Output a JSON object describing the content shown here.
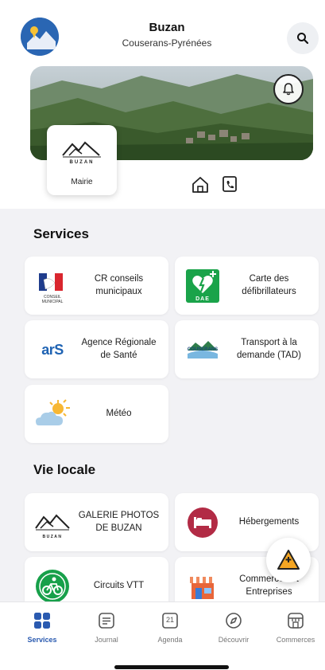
{
  "header": {
    "title": "Buzan",
    "subtitle": "Couserans-Pyrénées"
  },
  "mairie": {
    "logo_text": "BUZAN",
    "label": "Mairie"
  },
  "sections": {
    "services_title": "Services",
    "vie_locale_title": "Vie locale"
  },
  "services": [
    {
      "label": "CR conseils municipaux",
      "icon": "republique-francaise-logo",
      "icon_caption": "CONSEIL MUNICIPAL"
    },
    {
      "label": "Carte des défibrillateurs",
      "icon": "dae-defibrillator-icon",
      "icon_caption": "DAE"
    },
    {
      "label": "Agence Régionale de Santé",
      "icon": "ars-logo",
      "icon_caption": "arS"
    },
    {
      "label": "Transport à la demande (TAD)",
      "icon": "couserans-logo",
      "icon_caption": "COUSERANS"
    },
    {
      "label": "Météo",
      "icon": "weather-sun-cloud-icon"
    }
  ],
  "vie_locale": [
    {
      "label": "GALERIE PHOTOS DE BUZAN",
      "icon": "buzan-mountain-logo",
      "icon_caption": "BUZAN"
    },
    {
      "label": "Hébergements",
      "icon": "bed-icon"
    },
    {
      "label": "Circuits VTT",
      "icon": "bike-icon"
    },
    {
      "label": "Commerces et Entreprises",
      "icon": "shop-icon"
    }
  ],
  "bottom_nav": [
    {
      "label": "Services",
      "icon": "grid-icon",
      "active": true
    },
    {
      "label": "Journal",
      "icon": "newspaper-icon",
      "active": false
    },
    {
      "label": "Agenda",
      "icon": "calendar-icon",
      "active": false,
      "calendar_day": "21"
    },
    {
      "label": "Découvrir",
      "icon": "compass-icon",
      "active": false
    },
    {
      "label": "Commerces",
      "icon": "store-icon",
      "active": false
    }
  ],
  "colors": {
    "brand_blue": "#2a5ab0",
    "background": "#f2f2f5",
    "dae_green": "#1aa34a",
    "hotel_red": "#b22b45",
    "alert_orange": "#f5a623"
  }
}
